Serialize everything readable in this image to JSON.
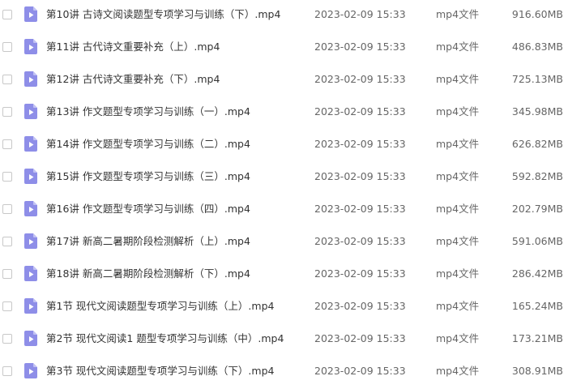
{
  "file_list": {
    "icon": "video-file-icon",
    "icon_color": "#8e8ee8",
    "items": [
      {
        "name": "第10讲 古诗文阅读题型专项学习与训练（下）.mp4",
        "date": "2023-02-09 15:33",
        "type": "mp4文件",
        "size": "916.60MB"
      },
      {
        "name": "第11讲 古代诗文重要补充（上）.mp4",
        "date": "2023-02-09 15:33",
        "type": "mp4文件",
        "size": "486.83MB"
      },
      {
        "name": "第12讲 古代诗文重要补充（下）.mp4",
        "date": "2023-02-09 15:33",
        "type": "mp4文件",
        "size": "725.13MB"
      },
      {
        "name": "第13讲 作文题型专项学习与训练（一）.mp4",
        "date": "2023-02-09 15:33",
        "type": "mp4文件",
        "size": "345.98MB"
      },
      {
        "name": "第14讲 作文题型专项学习与训练（二）.mp4",
        "date": "2023-02-09 15:33",
        "type": "mp4文件",
        "size": "626.82MB"
      },
      {
        "name": "第15讲 作文题型专项学习与训练（三）.mp4",
        "date": "2023-02-09 15:33",
        "type": "mp4文件",
        "size": "592.82MB"
      },
      {
        "name": "第16讲 作文题型专项学习与训练（四）.mp4",
        "date": "2023-02-09 15:33",
        "type": "mp4文件",
        "size": "202.79MB"
      },
      {
        "name": "第17讲 新高二暑期阶段检测解析（上）.mp4",
        "date": "2023-02-09 15:33",
        "type": "mp4文件",
        "size": "591.06MB"
      },
      {
        "name": "第18讲 新高二暑期阶段检测解析（下）.mp4",
        "date": "2023-02-09 15:33",
        "type": "mp4文件",
        "size": "286.42MB"
      },
      {
        "name": "第1节 现代文阅读题型专项学习与训练（上）.mp4",
        "date": "2023-02-09 15:33",
        "type": "mp4文件",
        "size": "165.24MB"
      },
      {
        "name": "第2节 现代文阅读1 题型专项学习与训练（中）.mp4",
        "date": "2023-02-09 15:33",
        "type": "mp4文件",
        "size": "173.21MB"
      },
      {
        "name": "第3节 现代文阅读题型专项学习与训练（下）.mp4",
        "date": "2023-02-09 15:33",
        "type": "mp4文件",
        "size": "308.91MB"
      }
    ]
  }
}
